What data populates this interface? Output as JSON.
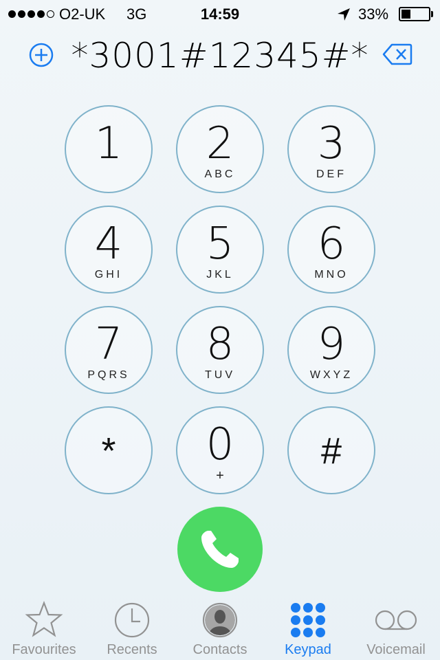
{
  "status_bar": {
    "carrier": "O2-UK",
    "network": "3G",
    "time": "14:59",
    "battery_percent": "33%",
    "battery_level": 0.33,
    "signal_bars_filled": 4,
    "signal_bars_total": 5
  },
  "dialer": {
    "number": "*3001#12345#*",
    "add_icon": "plus-circle-icon",
    "delete_icon": "backspace-icon"
  },
  "keypad": {
    "keys": [
      {
        "digit": "1",
        "letters": ""
      },
      {
        "digit": "2",
        "letters": "ABC"
      },
      {
        "digit": "3",
        "letters": "DEF"
      },
      {
        "digit": "4",
        "letters": "GHI"
      },
      {
        "digit": "5",
        "letters": "JKL"
      },
      {
        "digit": "6",
        "letters": "MNO"
      },
      {
        "digit": "7",
        "letters": "PQRS"
      },
      {
        "digit": "8",
        "letters": "TUV"
      },
      {
        "digit": "9",
        "letters": "WXYZ"
      },
      {
        "digit": "*",
        "letters": ""
      },
      {
        "digit": "0",
        "letters": "+"
      },
      {
        "digit": "#",
        "letters": ""
      }
    ]
  },
  "call_button": {
    "icon": "phone-icon",
    "color": "#4cd964"
  },
  "tab_bar": {
    "tabs": [
      {
        "label": "Favourites",
        "icon": "star-icon",
        "active": false
      },
      {
        "label": "Recents",
        "icon": "clock-icon",
        "active": false
      },
      {
        "label": "Contacts",
        "icon": "contact-icon",
        "active": false
      },
      {
        "label": "Keypad",
        "icon": "keypad-icon",
        "active": true
      },
      {
        "label": "Voicemail",
        "icon": "voicemail-icon",
        "active": false
      }
    ],
    "active_color": "#1a7cf0",
    "inactive_color": "#929292"
  }
}
